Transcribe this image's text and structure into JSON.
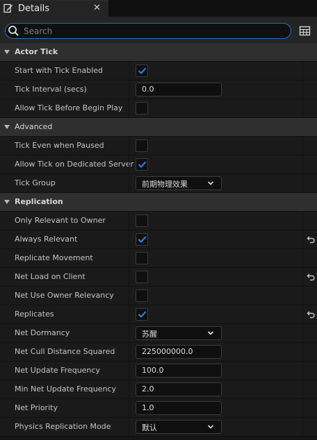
{
  "tab": {
    "title": "Details",
    "close": "✕"
  },
  "search": {
    "placeholder": "Search",
    "value": ""
  },
  "colors": {
    "accent": "#2a6cc4",
    "check": "#2f7ce0",
    "category_bg": "#2f2f2f",
    "row_bg": "#1a1a1a"
  },
  "sections": [
    {
      "title": "Actor Tick",
      "bold": true,
      "rows": [
        {
          "label": "Start with Tick Enabled",
          "type": "checkbox",
          "checked": true,
          "reset": false
        },
        {
          "label": "Tick Interval (secs)",
          "type": "number",
          "value": "0.0",
          "reset": false
        },
        {
          "label": "Allow Tick Before Begin Play",
          "type": "checkbox",
          "checked": false,
          "reset": false
        }
      ]
    },
    {
      "title": "Advanced",
      "bold": false,
      "rows": [
        {
          "label": "Tick Even when Paused",
          "type": "checkbox",
          "checked": false,
          "reset": false
        },
        {
          "label": "Allow Tick on Dedicated Server",
          "type": "checkbox",
          "checked": true,
          "reset": false
        },
        {
          "label": "Tick Group",
          "type": "combo",
          "value": "前期物理效果",
          "reset": false
        }
      ]
    },
    {
      "title": "Replication",
      "bold": true,
      "rows": [
        {
          "label": "Only Relevant to Owner",
          "type": "checkbox",
          "checked": false,
          "reset": false
        },
        {
          "label": "Always Relevant",
          "type": "checkbox",
          "checked": true,
          "reset": true
        },
        {
          "label": "Replicate Movement",
          "type": "checkbox",
          "checked": false,
          "reset": false
        },
        {
          "label": "Net Load on Client",
          "type": "checkbox",
          "checked": false,
          "reset": true
        },
        {
          "label": "Net Use Owner Relevancy",
          "type": "checkbox",
          "checked": false,
          "reset": false
        },
        {
          "label": "Replicates",
          "type": "checkbox",
          "checked": true,
          "reset": true
        },
        {
          "label": "Net Dormancy",
          "type": "combo",
          "value": "苏醒",
          "reset": false
        },
        {
          "label": "Net Cull Distance Squared",
          "type": "number",
          "value": "225000000.0",
          "reset": false
        },
        {
          "label": "Net Update Frequency",
          "type": "number",
          "value": "100.0",
          "reset": false
        },
        {
          "label": "Min Net Update Frequency",
          "type": "number",
          "value": "2.0",
          "reset": false
        },
        {
          "label": "Net Priority",
          "type": "number",
          "value": "1.0",
          "reset": false
        },
        {
          "label": "Physics Replication Mode",
          "type": "combo",
          "value": "默认",
          "reset": false
        }
      ]
    }
  ]
}
